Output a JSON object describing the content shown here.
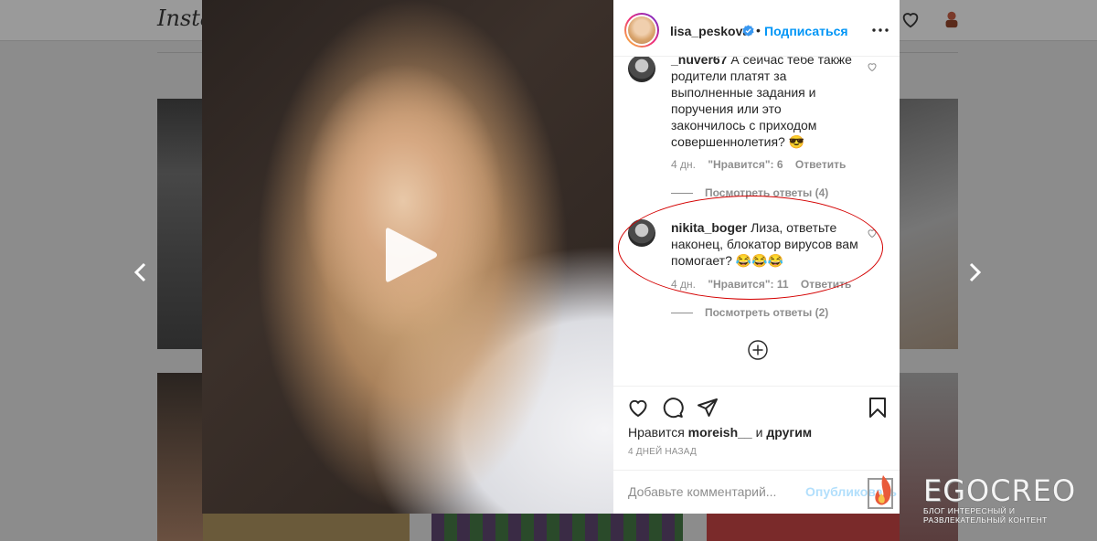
{
  "background": {
    "logo": "Insta"
  },
  "post": {
    "username": "lisa_peskova",
    "separator": "•",
    "follow_label": "Подписаться"
  },
  "comments": [
    {
      "username": "_nuver67",
      "text": "А сейчас тебе также родители платят за выполненные задания и поручения или это закончилось с приходом совершеннолетия? 😎",
      "age": "4 дн.",
      "likes": "\"Нравится\": 6",
      "reply": "Ответить",
      "view_replies": "Посмотреть ответы (4)"
    },
    {
      "username": "nikita_boger",
      "text": "Лиза, ответьте наконец, блокатор вирусов вам помогает? 😂😂😂",
      "age": "4 дн.",
      "likes": "\"Нравится\": 11",
      "reply": "Ответить",
      "view_replies": "Посмотреть ответы (2)"
    }
  ],
  "actions": {
    "liked_prefix": "Нравится",
    "liked_user": "moreish__",
    "liked_and": "и",
    "liked_others": "другим",
    "date": "4 ДНЕЙ НАЗАД"
  },
  "add_comment": {
    "placeholder": "Добавьте комментарий...",
    "post_label": "Опубликовать"
  },
  "watermark": {
    "brand": "EGOCREO",
    "tagline": "БЛОГ ИНТЕРЕСНЫЙ И РАЗВЛЕКАТЕЛЬНЫЙ КОНТЕНТ"
  },
  "colors": {
    "accent": "#0095f6",
    "highlight": "#d40000",
    "verified": "#3897f0"
  }
}
